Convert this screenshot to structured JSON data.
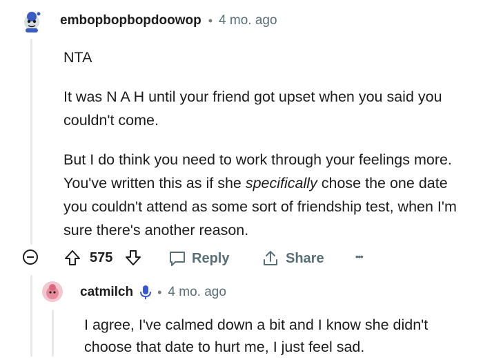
{
  "comment1": {
    "username": "embopbopbopdoowop",
    "separator": "•",
    "time": "4 mo. ago",
    "paragraphs": [
      "NTA",
      "It was N A H until your friend got upset when you said you couldn't come.",
      "But I do think you need to work through your feelings more. You've written this as if she specifically chose the one date you couldn't attend as some sort of friendship test, when I'm sure there's another reason."
    ],
    "emphasis_word": "specifically",
    "vote_count": "575",
    "reply_label": "Reply",
    "share_label": "Share",
    "more_label": "•••"
  },
  "comment2": {
    "username": "catmilch",
    "separator": "•",
    "time": "4 mo. ago",
    "text": "I agree, I've calmed down a bit and I know she didn't choose that date to hurt me, I just feel sad."
  },
  "colors": {
    "meta": "#576f76",
    "thread_line": "#e6e8ea",
    "avatar2": "#e98a9b"
  }
}
